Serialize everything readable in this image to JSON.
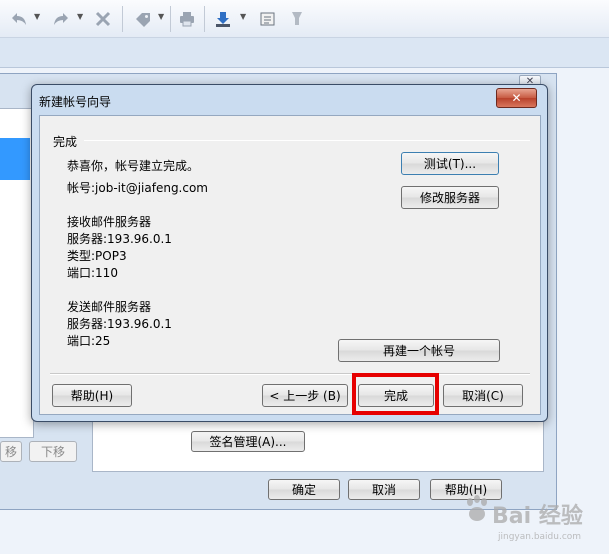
{
  "toolbar": {
    "icons": [
      "back-icon",
      "forward-icon",
      "delete-icon",
      "tag-icon",
      "print-icon",
      "download-icon",
      "address-book-icon",
      "filter-icon"
    ]
  },
  "background_dialog": {
    "close_label": "✕",
    "move_up_label": "移",
    "move_down_label": "下移",
    "signature_button": "签名管理(A)...",
    "ok_button": "确定",
    "cancel_button": "取消",
    "help_button": "帮助(H)"
  },
  "dialog": {
    "title": "新建帐号向导",
    "close_label": "✕",
    "group_label": "完成",
    "congrats": "恭喜你，帐号建立完成。",
    "account": "帐号:job-it@jiafeng.com",
    "incoming_header": "接收邮件服务器",
    "incoming_server": "服务器:193.96.0.1",
    "incoming_type": "类型:POP3",
    "incoming_port": "端口:110",
    "outgoing_header": "发送邮件服务器",
    "outgoing_server": "服务器:193.96.0.1",
    "outgoing_port": "端口:25",
    "test_button": "测试(T)...",
    "modify_server_button": "修改服务器",
    "new_account_button": "再建一个帐号",
    "help_button": "帮助(H)",
    "prev_button": "< 上一步 (B)",
    "finish_button": "完成",
    "cancel_button": "取消(C)"
  },
  "watermark": {
    "text": "Bai 经验",
    "sub": "jingyan.baidu.com"
  },
  "colors": {
    "highlight": "#e60000",
    "selection": "#3399ff",
    "dialog_frame": "#cadcf0"
  }
}
